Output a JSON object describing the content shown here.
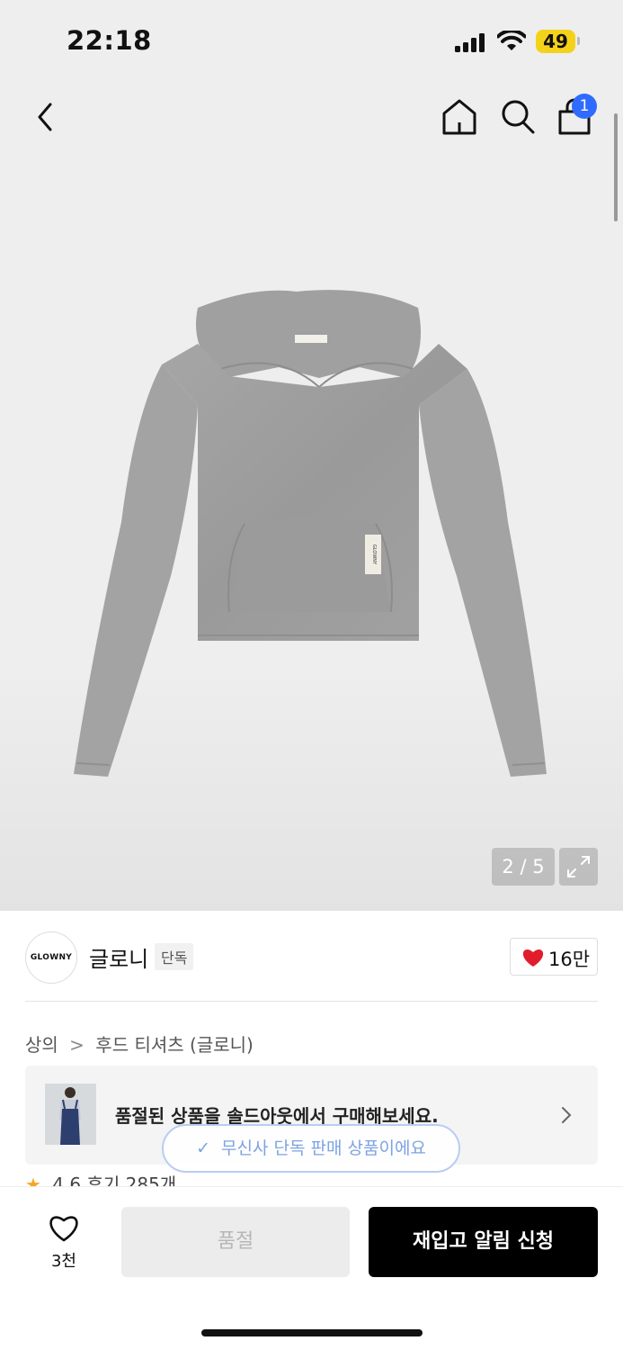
{
  "status_bar": {
    "time": "22:18",
    "battery": "49"
  },
  "header": {
    "cart_count": "1"
  },
  "gallery": {
    "counter": "2 / 5",
    "label_text": "GLOWNY"
  },
  "brand": {
    "logo_text": "GLOWNY",
    "name": "글로니",
    "tag": "단독",
    "likes": "16만"
  },
  "breadcrumb": {
    "category": "상의",
    "separator": ">",
    "subcategory": "후드 티셔츠 (글로니)"
  },
  "promo": {
    "text": "품절된 상품을 솔드아웃에서 구매해보세요."
  },
  "toast": {
    "text": "무신사 단독 판매 상품이에요"
  },
  "rating": {
    "score": "4.6",
    "reviews": "후기 285개"
  },
  "bottom_bar": {
    "wish_count": "3천",
    "soldout_label": "품절",
    "restock_label": "재입고 알림 신청"
  },
  "colors": {
    "accent": "#2f6bff",
    "heart": "#e01e2b",
    "battery": "#f5d21a",
    "primary_button": "#000000"
  }
}
